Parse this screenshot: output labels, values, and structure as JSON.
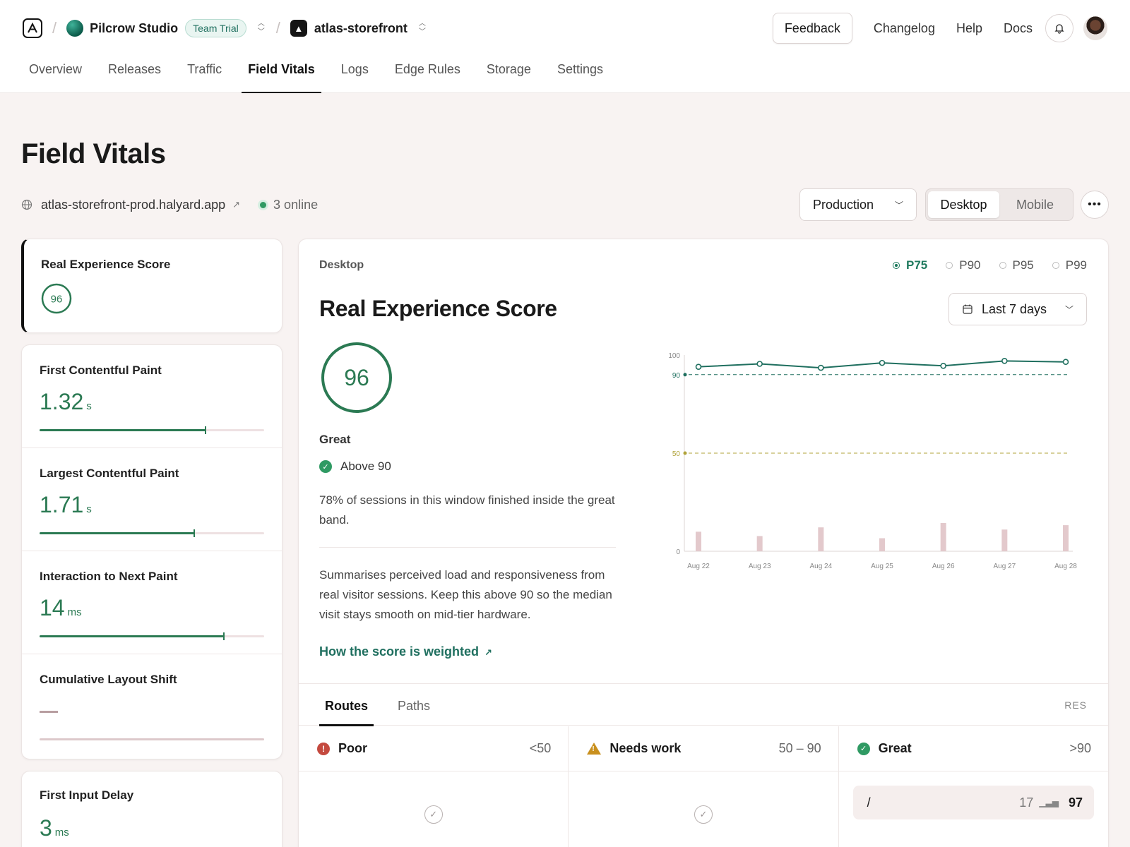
{
  "header": {
    "team": {
      "name": "Pilcrow Studio",
      "badge": "Team Trial"
    },
    "project": {
      "name": "atlas-storefront"
    },
    "actions": {
      "feedback": "Feedback",
      "changelog": "Changelog",
      "help": "Help",
      "docs": "Docs"
    },
    "tabs": [
      "Overview",
      "Releases",
      "Traffic",
      "Field Vitals",
      "Logs",
      "Edge Rules",
      "Storage",
      "Settings"
    ],
    "active_tab": "Field Vitals"
  },
  "page": {
    "title": "Field Vitals",
    "domain": "atlas-storefront-prod.halyard.app",
    "online": "3 online",
    "environment": "Production",
    "device_options": [
      "Desktop",
      "Mobile"
    ],
    "device_selected": "Desktop"
  },
  "metrics": {
    "res": {
      "label": "Real Experience Score",
      "value": "96"
    },
    "items": [
      {
        "label": "First Contentful Paint",
        "value": "1.32",
        "unit": "s",
        "progress": 0.74
      },
      {
        "label": "Largest Contentful Paint",
        "value": "1.71",
        "unit": "s",
        "progress": 0.69
      },
      {
        "label": "Interaction to Next Paint",
        "value": "14",
        "unit": "ms",
        "progress": 0.82
      },
      {
        "label": "Cumulative Layout Shift",
        "value": "",
        "unit": "",
        "progress": 0
      }
    ],
    "fid": {
      "label": "First Input Delay",
      "value": "3",
      "unit": "ms"
    }
  },
  "panel": {
    "kicker": "Desktop",
    "percentiles": [
      "P75",
      "P90",
      "P95",
      "P99"
    ],
    "percentile_selected": "P75",
    "title": "Real Experience Score",
    "date_range": "Last 7 days",
    "score": "96",
    "grade": "Great",
    "threshold_text": "Above 90",
    "session_text": "78% of sessions in this window finished inside the great band.",
    "description": "Summarises perceived load and responsiveness from real visitor sessions. Keep this above 90 so the median visit stays smooth on mid-tier hardware.",
    "link": "How the score is weighted"
  },
  "chart_data": {
    "type": "line",
    "x": [
      "Aug 22",
      "Aug 23",
      "Aug 24",
      "Aug 25",
      "Aug 26",
      "Aug 27",
      "Aug 28"
    ],
    "series": [
      {
        "values": [
          94,
          95.5,
          93.5,
          96,
          94.5,
          97,
          96.5
        ]
      }
    ],
    "volume": [
      9,
      7,
      11,
      6,
      13,
      10,
      12
    ],
    "thresholds": [
      {
        "label": "90",
        "value": 90,
        "color": "#1f6f5f"
      },
      {
        "label": "50",
        "value": 50,
        "color": "#b0a33a"
      }
    ],
    "yticks": [
      "100",
      "90",
      "50",
      "0"
    ],
    "ylim": [
      0,
      100
    ],
    "grid": false
  },
  "bottom": {
    "tabs": [
      "Routes",
      "Paths"
    ],
    "tab_selected": "Routes",
    "right_label": "RES",
    "columns": [
      {
        "name": "Poor",
        "range": "<50"
      },
      {
        "name": "Needs work",
        "range": "50 – 90"
      },
      {
        "name": "Great",
        "range": ">90"
      }
    ],
    "great_routes": [
      {
        "path": "/",
        "count": "17",
        "score": "97"
      }
    ]
  },
  "colors": {
    "accent": "#1f6f5f",
    "good": "#2b7a53",
    "poor": "#c44a3f",
    "warn": "#c9901e",
    "volume": "#e3c9cc"
  }
}
